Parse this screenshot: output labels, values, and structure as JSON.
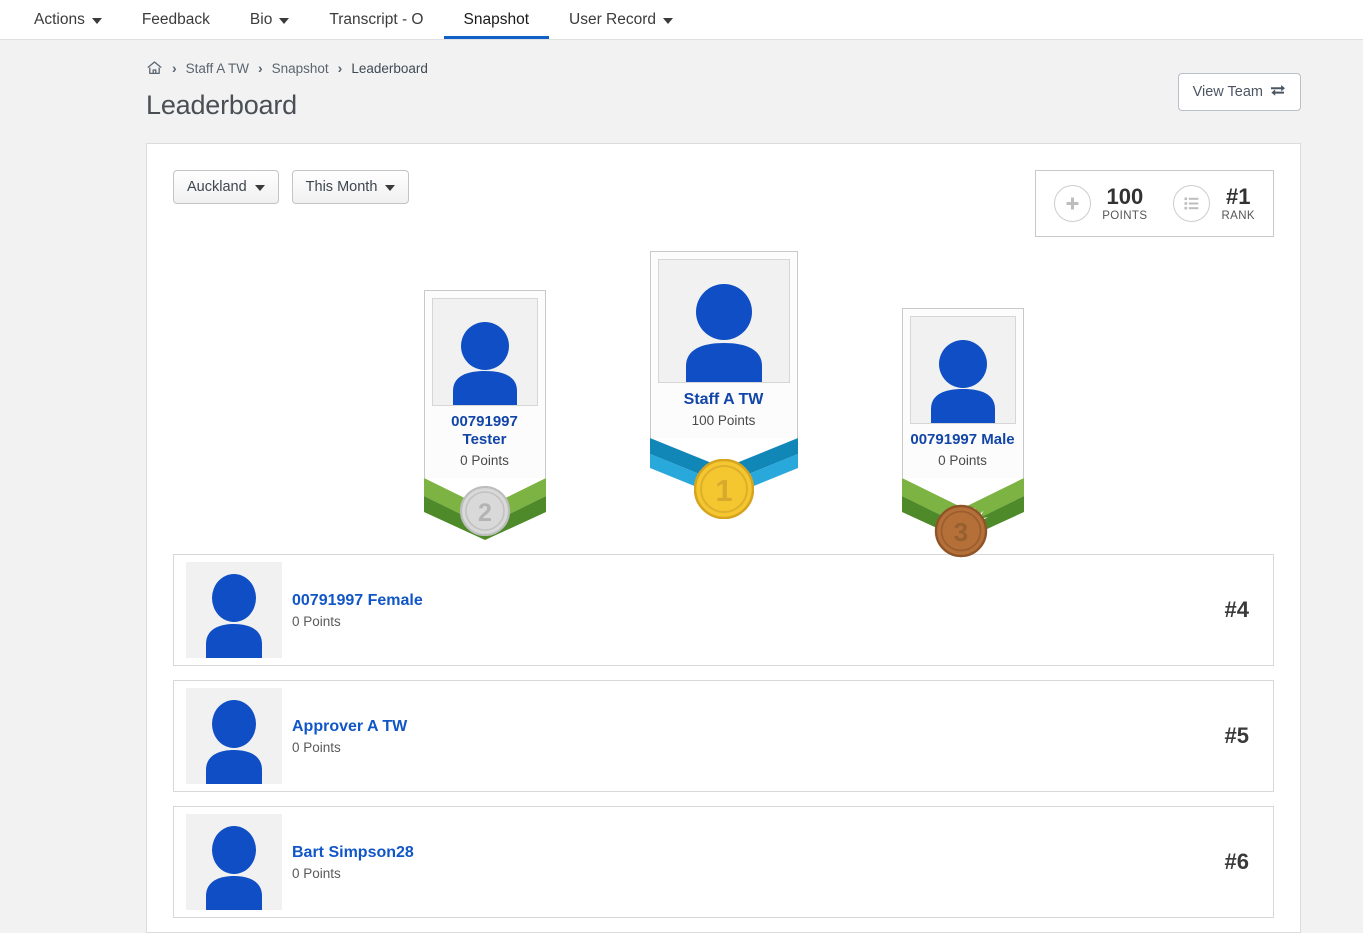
{
  "colors": {
    "accent_blue": "#1060c8",
    "name_blue": "#1245a8",
    "page_bg": "#f2f2f2",
    "gold": "#f4c630",
    "silver": "#cfcfcf",
    "bronze": "#b5703a",
    "ribbon_green_light": "#7cb342",
    "ribbon_green_dark": "#4e8a29",
    "ribbon_blue_light": "#29a8dc",
    "ribbon_blue_dark": "#1187b8"
  },
  "topnav": {
    "items": [
      {
        "label": "Actions",
        "has_caret": true,
        "active": false
      },
      {
        "label": "Feedback",
        "has_caret": false,
        "active": false
      },
      {
        "label": "Bio",
        "has_caret": true,
        "active": false
      },
      {
        "label": "Transcript - O",
        "has_caret": false,
        "active": false
      },
      {
        "label": "Snapshot",
        "has_caret": false,
        "active": true
      },
      {
        "label": "User Record",
        "has_caret": true,
        "active": false
      }
    ]
  },
  "breadcrumb": {
    "home_icon": "home-icon",
    "items": [
      {
        "label": "Staff A TW"
      },
      {
        "label": "Snapshot"
      },
      {
        "label": "Leaderboard"
      }
    ],
    "separator": "›"
  },
  "header": {
    "title": "Leaderboard",
    "view_team_label": "View Team",
    "view_team_icon": "switch-arrows-icon"
  },
  "filters": [
    {
      "label": "Auckland",
      "name": "location-filter"
    },
    {
      "label": "This Month",
      "name": "period-filter"
    }
  ],
  "stats": {
    "points": {
      "value": "100",
      "label": "POINTS",
      "icon": "plus-circle-icon"
    },
    "rank": {
      "value": "#1",
      "label": "RANK",
      "icon": "list-circle-icon"
    }
  },
  "podium": [
    {
      "place": 2,
      "medal_label": "2",
      "name": "00791997 Tester",
      "points": "0 Points",
      "ribbon": "green",
      "medal": "silver",
      "size": "size-2"
    },
    {
      "place": 1,
      "medal_label": "1",
      "name": "Staff A TW",
      "points": "100 Points",
      "ribbon": "blue",
      "medal": "gold",
      "size": "size-1"
    },
    {
      "place": 3,
      "medal_label": "3",
      "name": "00791997 Male",
      "points": "0 Points",
      "ribbon": "green",
      "medal": "bronze",
      "size": "size-2"
    }
  ],
  "list_rows": [
    {
      "name": "00791997 Female",
      "points": "0 Points",
      "rank": "#4"
    },
    {
      "name": "Approver A TW",
      "points": "0 Points",
      "rank": "#5"
    },
    {
      "name": "Bart Simpson28",
      "points": "0 Points",
      "rank": "#6"
    }
  ]
}
